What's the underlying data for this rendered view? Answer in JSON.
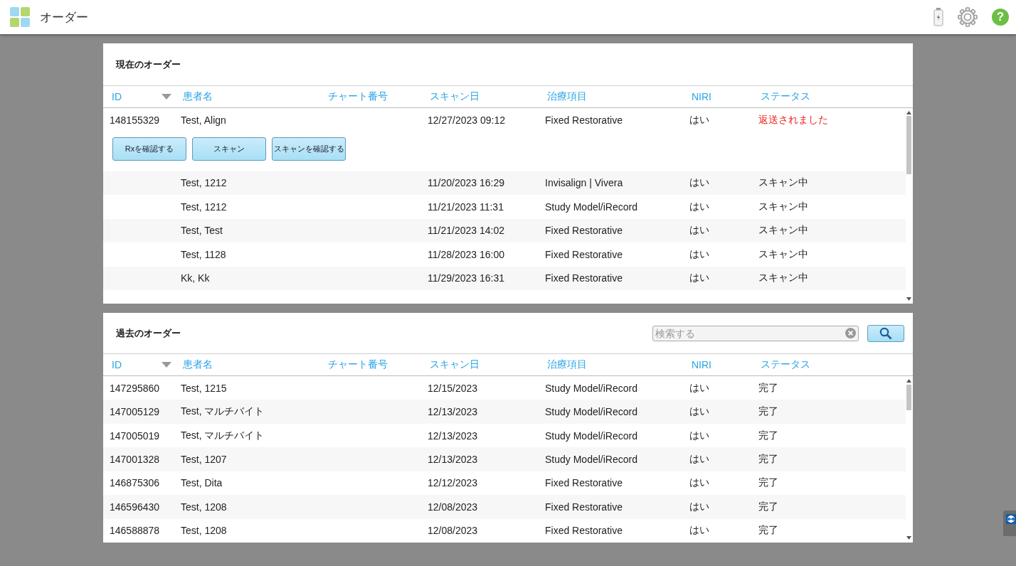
{
  "header": {
    "title": "オーダー",
    "help_icon": "?"
  },
  "current_orders": {
    "title": "現在のオーダー",
    "columns": [
      "ID",
      "患者名",
      "チャート番号",
      "スキャン日",
      "治療項目",
      "NIRI",
      "ステータス"
    ],
    "rows": [
      {
        "id": "148155329",
        "patient": "Test, Align",
        "scan_date": "12/27/2023 09:12",
        "treatment": "Fixed Restorative",
        "niri": "はい",
        "status": "返送されました",
        "color": "#f02020",
        "expanded": true,
        "actions": [
          "Rxを確認する",
          "スキャン",
          "スキャンを確認する"
        ]
      },
      {
        "patient": "Test, 1212",
        "scan_date": "11/20/2023 16:29",
        "treatment": "Invisalign | Vivera",
        "niri": "はい",
        "status": "スキャン中",
        "color": "#222222",
        "expanded": false
      },
      {
        "patient": "Test, 1212",
        "scan_date": "11/21/2023 11:31",
        "treatment": "Study Model/iRecord",
        "niri": "はい",
        "status": "スキャン中",
        "color": "#222222",
        "expanded": false
      },
      {
        "patient": "Test, Test",
        "scan_date": "11/21/2023 14:02",
        "treatment": "Fixed Restorative",
        "niri": "はい",
        "status": "スキャン中",
        "color": "#222222",
        "expanded": false
      },
      {
        "patient": "Test, 1128",
        "scan_date": "11/28/2023 16:00",
        "treatment": "Fixed Restorative",
        "niri": "はい",
        "status": "スキャン中",
        "color": "#222222",
        "expanded": false
      },
      {
        "patient": "Kk, Kk",
        "scan_date": "11/29/2023 16:31",
        "treatment": "Fixed Restorative",
        "niri": "はい",
        "status": "スキャン中",
        "color": "#222222",
        "expanded": false
      }
    ]
  },
  "past_orders": {
    "title": "過去のオーダー",
    "search": {
      "placeholder": "検索する"
    },
    "columns": [
      "ID",
      "患者名",
      "チャート番号",
      "スキャン日",
      "治療項目",
      "NIRI",
      "ステータス"
    ],
    "rows": [
      {
        "id": "147295860",
        "patient": "Test, 1215",
        "scan_date": "12/15/2023",
        "treatment": "Study Model/iRecord",
        "niri": "はい",
        "status": "完了"
      },
      {
        "id": "147005129",
        "patient": "Test, マルチバイト",
        "scan_date": "12/13/2023",
        "treatment": "Study Model/iRecord",
        "niri": "はい",
        "status": "完了"
      },
      {
        "id": "147005019",
        "patient": "Test, マルチバイト",
        "scan_date": "12/13/2023",
        "treatment": "Study Model/iRecord",
        "niri": "はい",
        "status": "完了"
      },
      {
        "id": "147001328",
        "patient": "Test, 1207",
        "scan_date": "12/13/2023",
        "treatment": "Study Model/iRecord",
        "niri": "はい",
        "status": "完了"
      },
      {
        "id": "146875306",
        "patient": "Test, Dita",
        "scan_date": "12/12/2023",
        "treatment": "Fixed Restorative",
        "niri": "はい",
        "status": "完了"
      },
      {
        "id": "146596430",
        "patient": "Test, 1208",
        "scan_date": "12/08/2023",
        "treatment": "Fixed Restorative",
        "niri": "はい",
        "status": "完了"
      },
      {
        "id": "146588878",
        "patient": "Test, 1208",
        "scan_date": "12/08/2023",
        "treatment": "Fixed Restorative",
        "niri": "はい",
        "status": "完了"
      }
    ]
  }
}
